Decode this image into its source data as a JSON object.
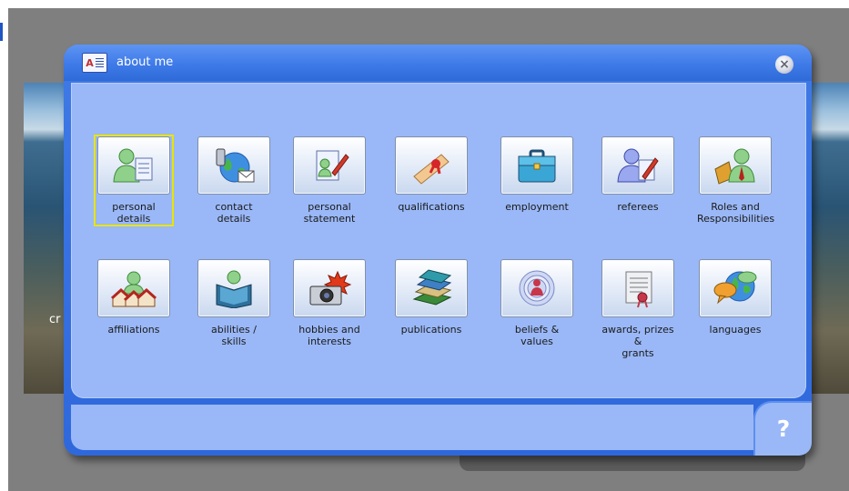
{
  "dialog": {
    "title": "about me",
    "close_symbol": "×",
    "help_symbol": "?"
  },
  "background": {
    "partial_text": "cr"
  },
  "tiles": [
    {
      "label": "personal\ndetails",
      "icon": "person-document-icon",
      "selected": true
    },
    {
      "label": "contact\ndetails",
      "icon": "globe-phone-mail-icon",
      "selected": false
    },
    {
      "label": "personal\nstatement",
      "icon": "document-pen-icon",
      "selected": false
    },
    {
      "label": "qualifications",
      "icon": "diploma-scroll-icon",
      "selected": false
    },
    {
      "label": "employment",
      "icon": "briefcase-icon",
      "selected": false
    },
    {
      "label": "referees",
      "icon": "person-pen-icon",
      "selected": false
    },
    {
      "label": "Roles and\nResponsibilities",
      "icon": "person-tie-book-icon",
      "selected": false
    },
    {
      "label": "affiliations",
      "icon": "person-houses-icon",
      "selected": false
    },
    {
      "label": "abilities /\nskills",
      "icon": "person-reading-icon",
      "selected": false
    },
    {
      "label": "hobbies and\ninterests",
      "icon": "camera-icon",
      "selected": false
    },
    {
      "label": "publications",
      "icon": "books-icon",
      "selected": false
    },
    {
      "label": "beliefs &\nvalues",
      "icon": "person-target-icon",
      "selected": false
    },
    {
      "label": "awards, prizes &\ngrants",
      "icon": "certificate-icon",
      "selected": false
    },
    {
      "label": "languages",
      "icon": "globe-speech-icon",
      "selected": false
    }
  ]
}
